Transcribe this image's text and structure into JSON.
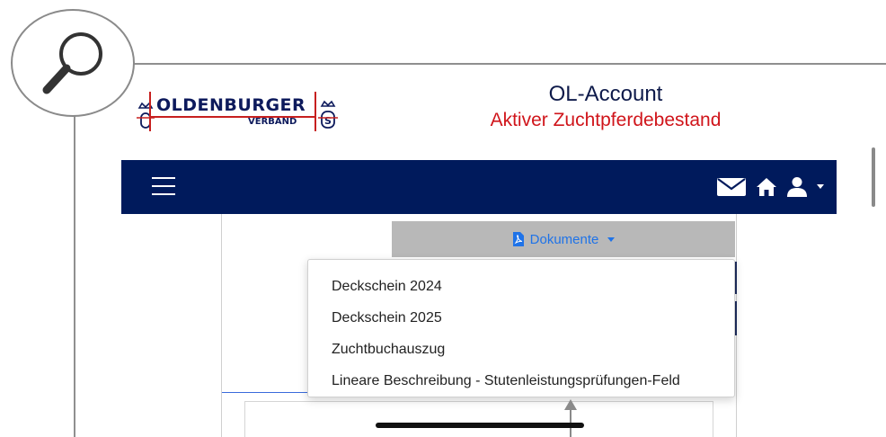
{
  "header": {
    "logo_main": "OLDENBURGER",
    "logo_sub": "VERBAND",
    "title": "OL-Account",
    "subtitle": "Aktiver Zuchtpferdebestand"
  },
  "navbar": {
    "menu_icon": "hamburger-menu-icon",
    "icons": [
      "envelope-icon",
      "home-icon",
      "user-icon",
      "caret-down-icon"
    ]
  },
  "documents": {
    "button_label": "Dokumente",
    "button_icon": "pdf-file-icon",
    "items": [
      "Deckschein 2024",
      "Deckschein 2025",
      "Zuchtbuchauszug",
      "Lineare Beschreibung - Stutenleistungsprüfungen-Feld"
    ]
  },
  "overlay": {
    "zoom_icon": "magnifier-icon"
  },
  "colors": {
    "navbar": "#001a5c",
    "title": "#0e1a4a",
    "subtitle": "#d0151b",
    "link_blue": "#1f73e8",
    "button_gray": "#b8b8b8"
  }
}
